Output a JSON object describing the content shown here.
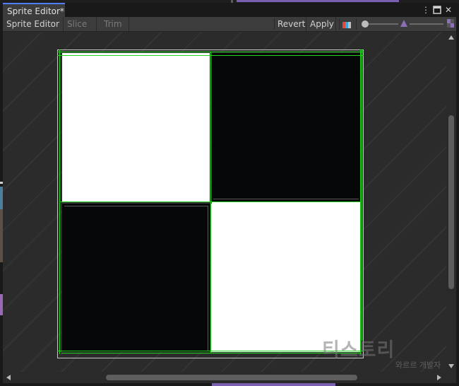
{
  "window": {
    "tab_title": "Sprite Editor*"
  },
  "toolbar": {
    "mode_dropdown": "Sprite Editor",
    "slice_label": "Slice",
    "trim_label": "Trim",
    "revert_label": "Revert",
    "apply_label": "Apply",
    "zoom_level": 0.08,
    "mip_level": 0.4
  },
  "sprite": {
    "tiles": [
      {
        "position": "top-left",
        "color": "white"
      },
      {
        "position": "top-right",
        "color": "black"
      },
      {
        "position": "bottom-left",
        "color": "black"
      },
      {
        "position": "bottom-right",
        "color": "white"
      }
    ],
    "outline_color": "#21d51d"
  },
  "watermark": {
    "text": "티스토리",
    "sub_text": "와르르 개발자"
  },
  "colors": {
    "accent": "#4c7eff",
    "selection": "#7b5fb0",
    "panel": "#282828",
    "toolbar": "#3c3c3c"
  }
}
